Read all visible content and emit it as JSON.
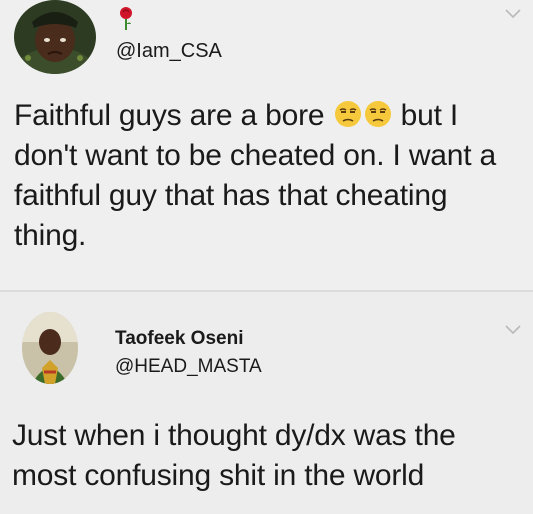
{
  "tweet1": {
    "handle": "@Iam_CSA",
    "text_a": "Faithful guys are a bore ",
    "text_b": " but I don't want to be cheated on. I want a faithful guy that has that cheating thing.",
    "emoji_name": "unamused-face-icon"
  },
  "tweet2": {
    "display_name": "Taofeek Oseni",
    "handle": "@HEAD_MASTA",
    "text": "Just when i thought dy/dx was the most confusing shit in the world"
  },
  "colors": {
    "background": "#ececec",
    "rose": "#d0142a",
    "emoji": "#f6c83c",
    "divider": "#dcdcdc"
  }
}
